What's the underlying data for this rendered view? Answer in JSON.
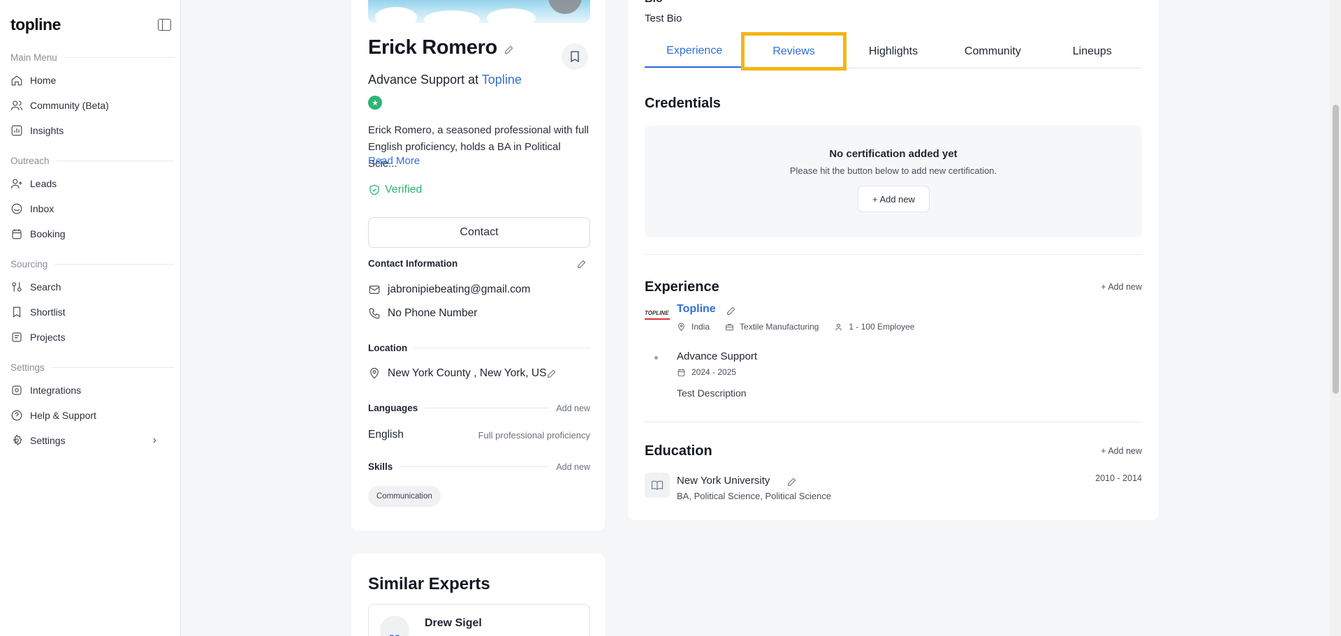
{
  "sidebar": {
    "brand": "topline",
    "sections": [
      {
        "label": "Main Menu",
        "items": [
          {
            "label": "Home",
            "icon": "home-icon"
          },
          {
            "label": "Community (Beta)",
            "icon": "users-icon"
          },
          {
            "label": "Insights",
            "icon": "chart-icon"
          }
        ]
      },
      {
        "label": "Outreach",
        "items": [
          {
            "label": "Leads",
            "icon": "user-plus-icon"
          },
          {
            "label": "Inbox",
            "icon": "inbox-icon"
          },
          {
            "label": "Booking",
            "icon": "calendar-icon"
          }
        ]
      },
      {
        "label": "Sourcing",
        "items": [
          {
            "label": "Search",
            "icon": "sliders-icon"
          },
          {
            "label": "Shortlist",
            "icon": "bookmark-icon"
          },
          {
            "label": "Projects",
            "icon": "folder-icon"
          }
        ]
      },
      {
        "label": "Settings",
        "items": [
          {
            "label": "Integrations",
            "icon": "integrations-icon"
          },
          {
            "label": "Help & Support",
            "icon": "help-icon"
          },
          {
            "label": "Settings",
            "icon": "gear-icon"
          }
        ]
      }
    ]
  },
  "profile": {
    "name": "Erick Romero",
    "role_prefix": "Advance Support at ",
    "company_link": "Topline",
    "bio_summary": "Erick Romero, a seasoned professional with full English proficiency, holds a BA in Political Scie...",
    "read_more": "Read More",
    "verified": "Verified",
    "contact_button": "Contact",
    "contact_info_label": "Contact Information",
    "email": "jabronipiebeating@gmail.com",
    "phone": "No Phone Number",
    "location_label": "Location",
    "location": "New York County , New York, US",
    "languages_label": "Languages",
    "languages_add": "Add new",
    "language": "English",
    "language_level": "Full professional proficiency",
    "skills_label": "Skills",
    "skills_add": "Add new",
    "skills": [
      "Communication"
    ]
  },
  "similar": {
    "title": "Similar Experts",
    "expert_initials": "DS",
    "expert_name": "Drew Sigel"
  },
  "detail": {
    "bio_label": "Bio",
    "bio_text": "Test Bio",
    "tabs": [
      "Experience",
      "Reviews",
      "Highlights",
      "Community",
      "Lineups"
    ],
    "credentials_title": "Credentials",
    "no_cert": "No certification added yet",
    "no_cert_hint": "Please hit the button below to add new certification.",
    "add_new_button": "+ Add new",
    "experience_title": "Experience",
    "add_new_link": "+ Add new",
    "company": "Topline",
    "company_logo_text": "TOPLINE",
    "country": "India",
    "industry": "Textile Manufacturing",
    "employees": "1 - 100 Employee",
    "job_title": "Advance Support",
    "job_dates": "2024 - 2025",
    "job_desc": "Test Description",
    "education_title": "Education",
    "school": "New York University",
    "degree": "BA, Political Science, Political Science",
    "edu_years": "2010 - 2014"
  },
  "colors": {
    "accent": "#2f6fd6",
    "verified": "#2bb673",
    "highlight": "#f5b514"
  }
}
